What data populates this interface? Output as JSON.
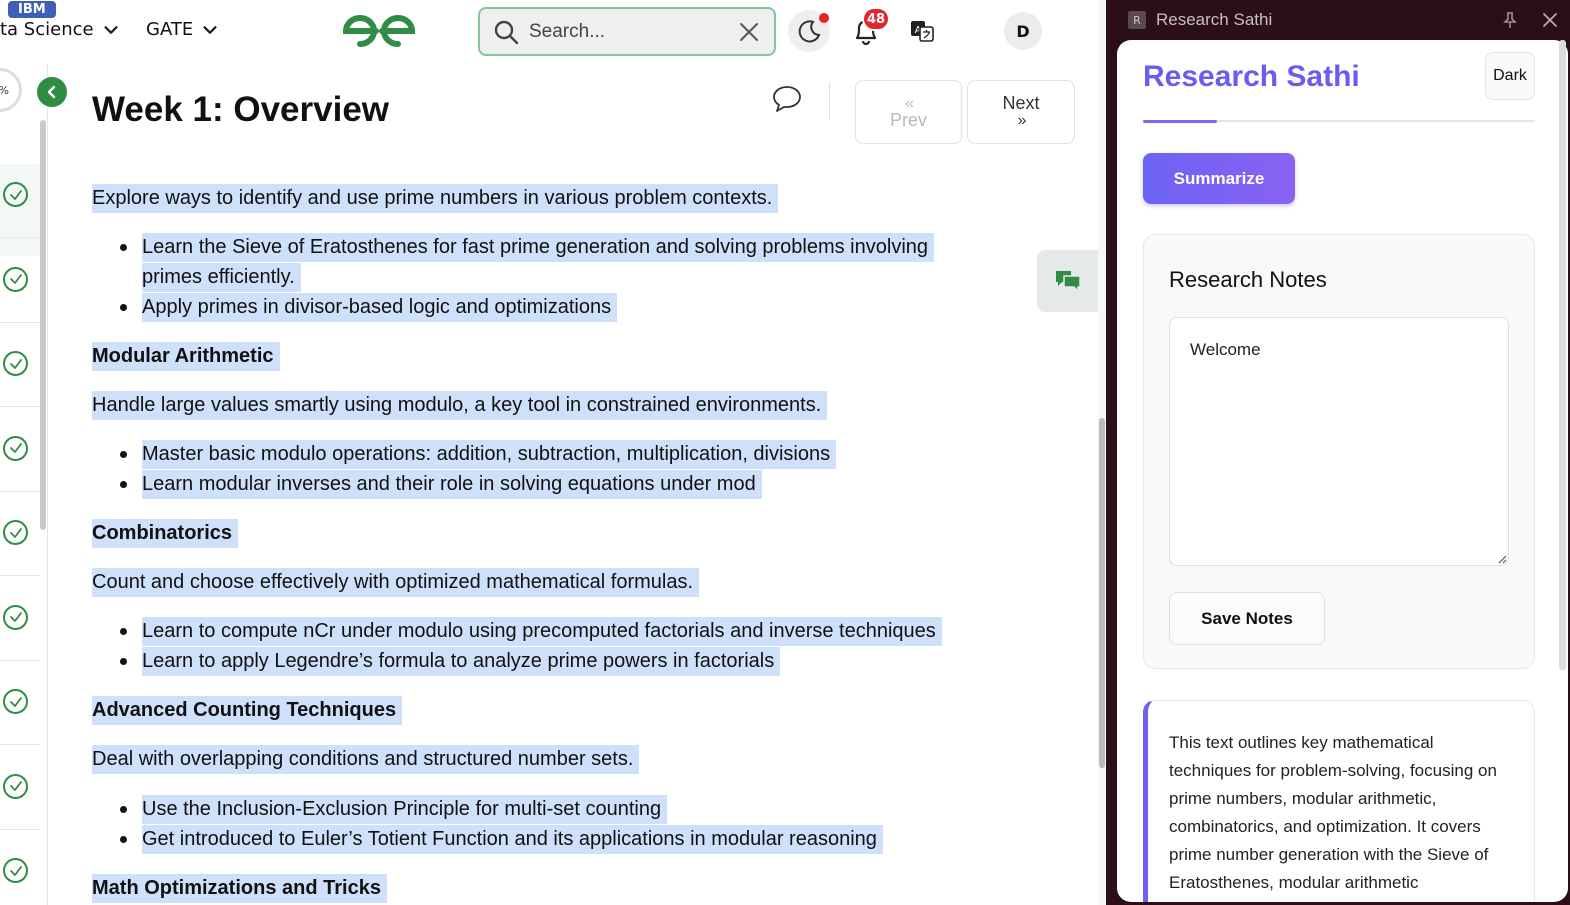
{
  "topbar": {
    "badge": "IBM",
    "nav": [
      {
        "label": "ta Science"
      },
      {
        "label": "GATE"
      }
    ],
    "search_placeholder": "Search...",
    "notification_count": "48",
    "avatar_initial": "D",
    "colors": {
      "brand": "#2f8d46",
      "badge": "#3d5fb8",
      "alert": "#e3262b"
    }
  },
  "rail": {
    "progress_label": "%",
    "completed_items": 9
  },
  "article": {
    "title": "Week 1: Overview",
    "prev_label": "Prev",
    "next_label": "Next",
    "prev_chevron": "«",
    "next_chevron": "»",
    "blocks": [
      {
        "type": "p",
        "text": "Explore ways to identify and use prime numbers in various problem contexts."
      },
      {
        "type": "li",
        "text": "Learn the Sieve of Eratosthenes for fast prime generation and solving problems involving"
      },
      {
        "type": "li-cont",
        "text": "primes efficiently."
      },
      {
        "type": "li",
        "text": "Apply primes in divisor-based logic and optimizations"
      },
      {
        "type": "h",
        "text": "Modular Arithmetic"
      },
      {
        "type": "p",
        "text": "Handle large values smartly using modulo, a key tool in constrained environments."
      },
      {
        "type": "li",
        "text": "Master basic modulo operations: addition, subtraction, multiplication, divisions"
      },
      {
        "type": "li",
        "text": "Learn modular inverses and their role in solving equations under mod"
      },
      {
        "type": "h",
        "text": "Combinatorics"
      },
      {
        "type": "p",
        "text": "Count and choose effectively with optimized mathematical formulas."
      },
      {
        "type": "li",
        "text": "Learn to compute nCr under modulo using precomputed factorials and inverse techniques"
      },
      {
        "type": "li",
        "text": "Learn to apply Legendre’s formula to analyze prime powers in factorials"
      },
      {
        "type": "h",
        "text": "Advanced Counting Techniques"
      },
      {
        "type": "p",
        "text": "Deal with overlapping conditions and structured number sets."
      },
      {
        "type": "li",
        "text": "Use the Inclusion-Exclusion Principle for multi-set counting"
      },
      {
        "type": "li",
        "text": "Get introduced to Euler’s Totient Function and its applications in modular reasoning"
      },
      {
        "type": "h",
        "text": "Math Optimizations and Tricks"
      }
    ],
    "highlight_color": "#cfe0fb"
  },
  "panel": {
    "window_title": "Research Sathi",
    "window_icon_letter": "R",
    "title": "Research Sathi",
    "theme_toggle": "Dark",
    "summarize_label": "Summarize",
    "notes_title": "Research Notes",
    "notes_value": "Welcome",
    "save_label": "Save Notes",
    "summary_text": "This text outlines key mathematical techniques for problem-solving, focusing on prime numbers, modular arithmetic, combinatorics, and optimization. It covers prime number generation with the Sieve of Eratosthenes, modular arithmetic",
    "accent_color": "#6b5cf0"
  }
}
